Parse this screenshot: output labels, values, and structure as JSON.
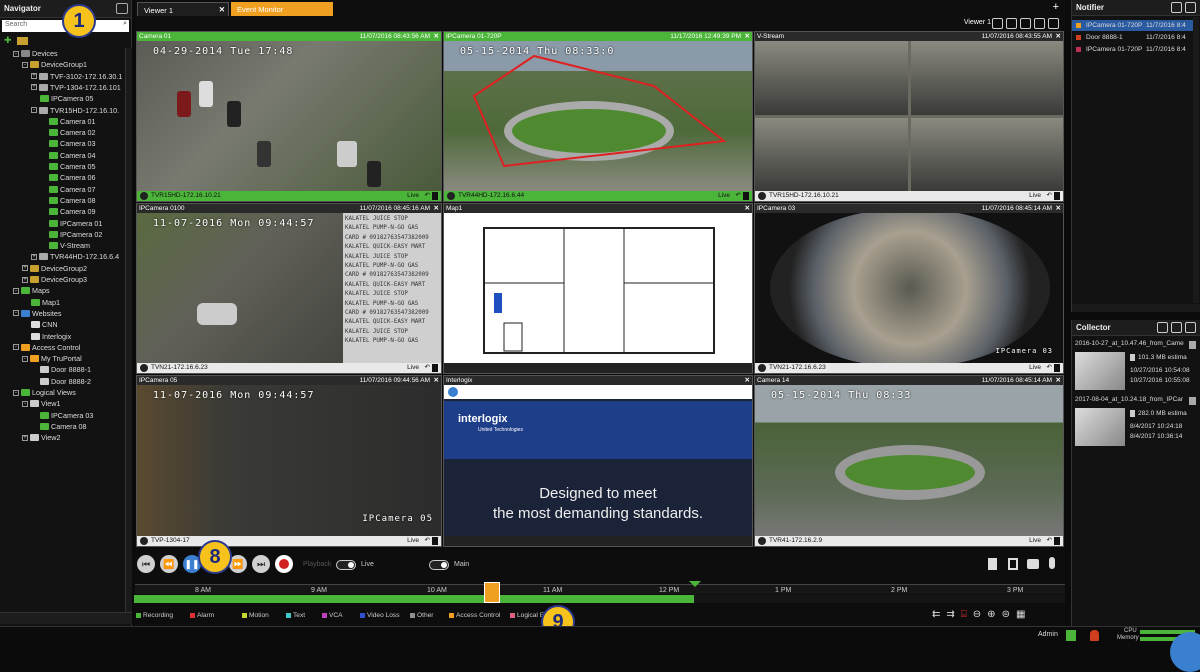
{
  "navigator": {
    "title": "Navigator",
    "search_placeholder": "Search",
    "tree": [
      {
        "label": "Devices",
        "indent": 1,
        "icon": "devices-icon",
        "exp": "-"
      },
      {
        "label": "DeviceGroup1",
        "indent": 2,
        "icon": "folder-icon",
        "exp": "-"
      },
      {
        "label": "TVF-3102-172.16.30.1",
        "indent": 3,
        "icon": "recorder-icon",
        "exp": "+"
      },
      {
        "label": "TVP-1304-172.16.101",
        "indent": 3,
        "icon": "recorder-icon",
        "exp": "+"
      },
      {
        "label": "IPCamera 05",
        "indent": 4,
        "icon": "ptz-camera-icon",
        "exp": ""
      },
      {
        "label": "TVR15HD-172.16.10.",
        "indent": 3,
        "icon": "recorder-icon",
        "exp": "-"
      },
      {
        "label": "Camera 01",
        "indent": 5,
        "icon": "camera-icon",
        "exp": ""
      },
      {
        "label": "Camera 02",
        "indent": 5,
        "icon": "camera-icon",
        "exp": ""
      },
      {
        "label": "Camera 03",
        "indent": 5,
        "icon": "camera-icon",
        "exp": ""
      },
      {
        "label": "Camera 04",
        "indent": 5,
        "icon": "camera-icon",
        "exp": ""
      },
      {
        "label": "Camera 05",
        "indent": 5,
        "icon": "camera-icon",
        "exp": ""
      },
      {
        "label": "Camera 06",
        "indent": 5,
        "icon": "camera-icon",
        "exp": ""
      },
      {
        "label": "Camera 07",
        "indent": 5,
        "icon": "camera-icon",
        "exp": ""
      },
      {
        "label": "Camera 08",
        "indent": 5,
        "icon": "camera-icon",
        "exp": ""
      },
      {
        "label": "Camera 09",
        "indent": 5,
        "icon": "camera-icon",
        "exp": ""
      },
      {
        "label": "IPCamera 01",
        "indent": 5,
        "icon": "camera-icon",
        "exp": ""
      },
      {
        "label": "IPCamera 02",
        "indent": 5,
        "icon": "camera-icon",
        "exp": ""
      },
      {
        "label": "V-Stream",
        "indent": 5,
        "icon": "vstream-icon",
        "exp": ""
      },
      {
        "label": "TVR44HD-172.16.6.4",
        "indent": 3,
        "icon": "recorder-icon",
        "exp": "+"
      },
      {
        "label": "DeviceGroup2",
        "indent": 2,
        "icon": "folder-icon",
        "exp": "+"
      },
      {
        "label": "DeviceGroup3",
        "indent": 2,
        "icon": "folder-icon",
        "exp": "+"
      },
      {
        "label": "Maps",
        "indent": 1,
        "icon": "map-icon",
        "exp": "-"
      },
      {
        "label": "Map1",
        "indent": 3,
        "icon": "map-pin-icon",
        "exp": ""
      },
      {
        "label": "Websites",
        "indent": 1,
        "icon": "globe-icon",
        "exp": "-"
      },
      {
        "label": "CNN",
        "indent": 3,
        "icon": "website-icon",
        "exp": ""
      },
      {
        "label": "Interlogix",
        "indent": 3,
        "icon": "website-icon",
        "exp": ""
      },
      {
        "label": "Access Control",
        "indent": 1,
        "icon": "access-control-icon",
        "exp": "-"
      },
      {
        "label": "My TruPortal",
        "indent": 2,
        "icon": "portal-icon",
        "exp": "-"
      },
      {
        "label": "Door 8888-1",
        "indent": 4,
        "icon": "door-icon",
        "exp": ""
      },
      {
        "label": "Door 8888-2",
        "indent": 4,
        "icon": "door-icon",
        "exp": ""
      },
      {
        "label": "Logical Views",
        "indent": 1,
        "icon": "logical-views-icon",
        "exp": "-"
      },
      {
        "label": "View1",
        "indent": 2,
        "icon": "view-icon",
        "exp": "-"
      },
      {
        "label": "IPCamera 03",
        "indent": 4,
        "icon": "camera-icon",
        "exp": ""
      },
      {
        "label": "Camera 08",
        "indent": 4,
        "icon": "camera-icon",
        "exp": ""
      },
      {
        "label": "View2",
        "indent": 2,
        "icon": "view-icon",
        "exp": "+"
      }
    ]
  },
  "tabs": [
    {
      "label": "Viewer 1",
      "active": true
    },
    {
      "label": "Event Monitor",
      "active": false
    }
  ],
  "viewer_label": "Viewer 1",
  "tiles": [
    {
      "name": "Camera 01",
      "date": "11/07/2016 08:43:56 AM",
      "osd": "04-29-2014 Tue 17:48",
      "source": "TVR15HD-172.16.10.21",
      "live": "Live",
      "green": true
    },
    {
      "name": "IPCamera 01-720P",
      "date": "11/17/2016 12:49:39 PM",
      "osd": "05-15-2014 Thu 08:33:0",
      "source": "TVR44HD-172.16.6.44",
      "live": "Live",
      "green": true
    },
    {
      "name": "V-Stream",
      "date": "11/07/2016 08:43:55 AM",
      "osd": "",
      "source": "TVR15HD-172.16.10.21",
      "live": "Live",
      "green": false
    },
    {
      "name": "IPCamera 0100",
      "date": "11/07/2016 08:45:16 AM",
      "osd": "11-07-2016 Mon 09:44:57",
      "source": "TVN21-172.16.6.23",
      "live": "Live",
      "green": false
    },
    {
      "name": "Map1",
      "date": "",
      "osd": "",
      "source": "",
      "live": "",
      "green": false
    },
    {
      "name": "IPCamera 03",
      "date": "11/07/2016 08:45:14 AM",
      "osd": "IPCamera 03",
      "source": "TVN21-172.16.6.23",
      "live": "Live",
      "green": false
    },
    {
      "name": "IPCamera 05",
      "date": "11/07/2016 09:44:56 AM",
      "osd": "11-07-2016 Mon 09:44:57",
      "source": "TVP-1304-17",
      "live": "Live",
      "green": false
    },
    {
      "name": "Interlogix",
      "date": "",
      "osd": "",
      "source": "",
      "live": "",
      "green": false
    },
    {
      "name": "Camera 14",
      "date": "11/07/2016 08:45:14 AM",
      "osd": "05-15-2014 Thu 08:33",
      "source": "TVR41-172.16.2.9",
      "live": "Live",
      "green": false
    }
  ],
  "ipcam05_label": "IPCamera 05",
  "pos_text": [
    "KALATEL JUICE STOP",
    "KALATEL PUMP-N-GO GAS",
    "CARD # 09182763547382009",
    "KALATEL QUICK-EASY MART",
    "KALATEL JUICE STOP",
    "KALATEL PUMP-N-GO GAS",
    "CARD # 09182763547382009",
    "KALATEL QUICK-EASY MART",
    "KALATEL JUICE STOP",
    "KALATEL PUMP-N-GO GAS",
    "CARD # 09182763547382009",
    "KALATEL QUICK-EASY MART",
    "KALATEL JUICE STOP",
    "KALATEL PUMP-N-GO GAS"
  ],
  "interlogix": {
    "brand": "interlogix",
    "sub": "United Technologies",
    "tag1": "Designed to meet",
    "tag2": "the most demanding standards."
  },
  "notifier": {
    "title": "Notifier",
    "rows": [
      {
        "label": "IPCamera 01-720P",
        "time": "11/7/2016 8:4",
        "color": "#f0a020",
        "selected": true
      },
      {
        "label": "Door 8888-1",
        "time": "11/7/2016 8:4",
        "color": "#d04020",
        "selected": false
      },
      {
        "label": "IPCamera 01-720P",
        "time": "11/7/2016 8:4",
        "color": "#c03050",
        "selected": false
      }
    ]
  },
  "collector": {
    "title": "Collector",
    "items": [
      {
        "name": "2016-10-27_at_10.47.46_from_Came",
        "size": "101.3 MB estima",
        "t1": "10/27/2016 10:54:08",
        "t2": "10/27/2016 10:55:08"
      },
      {
        "name": "2017-08-04_at_10.24.18_from_IPCar",
        "size": "282.0 MB estima",
        "t1": "8/4/2017 10:24:18",
        "t2": "8/4/2017 10:36:14"
      }
    ]
  },
  "playback": {
    "playback_label": "Playback",
    "live_label": "Live",
    "main_label": "Main",
    "ticks": [
      "8 AM",
      "9 AM",
      "10 AM",
      "11 AM",
      "12 PM",
      "1 PM",
      "2 PM",
      "3 PM"
    ]
  },
  "legend": [
    {
      "label": "Recording",
      "color": "#4bb53a"
    },
    {
      "label": "Alarm",
      "color": "#e03030"
    },
    {
      "label": "Motion",
      "color": "#c8d830"
    },
    {
      "label": "Text",
      "color": "#40c8c8"
    },
    {
      "label": "VCA",
      "color": "#c040c0"
    },
    {
      "label": "Video Loss",
      "color": "#3050d0"
    },
    {
      "label": "Other",
      "color": "#909090"
    },
    {
      "label": "Access Control",
      "color": "#f0a020"
    },
    {
      "label": "Logical E",
      "color": "#e06080"
    }
  ],
  "callouts": [
    "1",
    "8",
    "9"
  ],
  "status": {
    "user": "Admin",
    "cpu": "CPU",
    "memory": "Memory"
  }
}
